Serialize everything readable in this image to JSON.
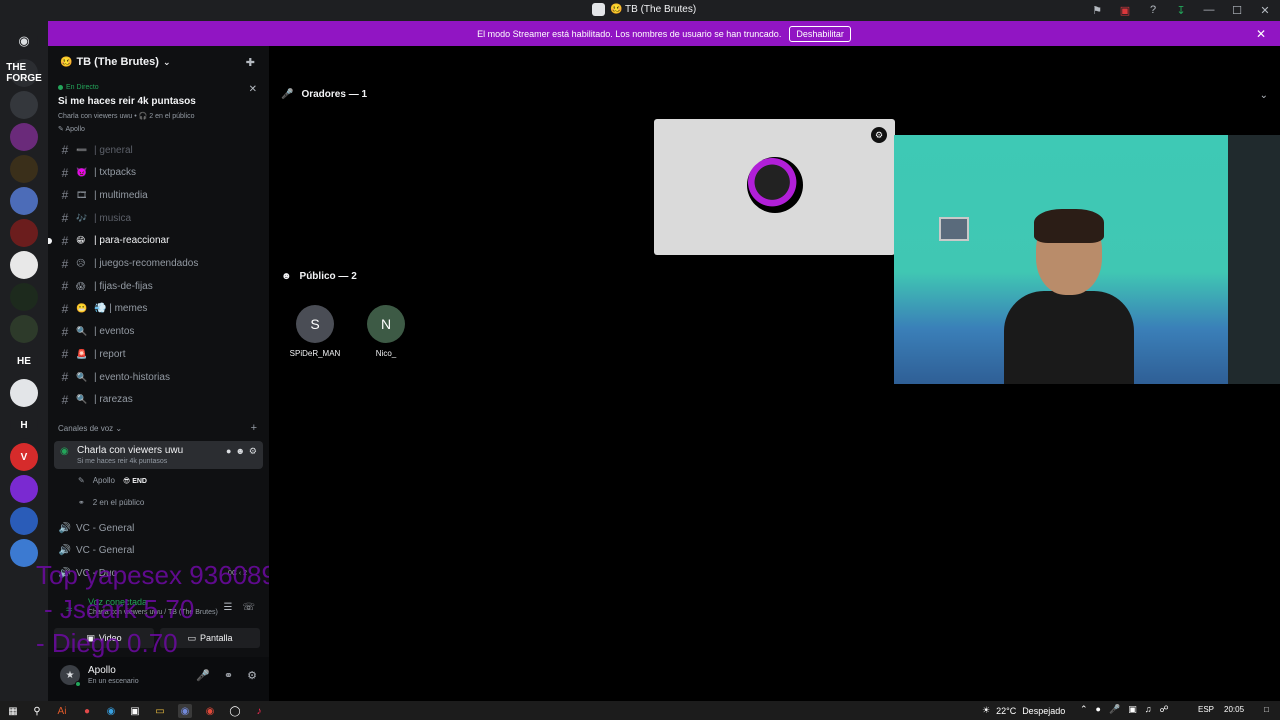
{
  "titlebar": {
    "title": "🥴 TB (The Brutes)",
    "icons": [
      "inbox-icon",
      "stream-icon",
      "help-icon",
      "download-icon",
      "minimize-icon",
      "maximize-icon",
      "close-icon"
    ]
  },
  "rail": {
    "home_icon": "discord-icon",
    "servers": [
      {
        "label": "THE FORGE",
        "color": "#2b2d31"
      },
      {
        "label": "",
        "color": "#34373c"
      },
      {
        "label": "",
        "color": "#6a2a7a"
      },
      {
        "label": "",
        "color": "#3a2f1a"
      },
      {
        "label": "",
        "color": "#4c6cb8"
      },
      {
        "label": "",
        "color": "#6b1d1d"
      },
      {
        "label": "",
        "color": "#e8e8e8"
      },
      {
        "label": "",
        "color": "#1d2a1d"
      },
      {
        "label": "",
        "color": "#2d3a2a"
      },
      {
        "label": "HE",
        "color": "#1e1f22"
      },
      {
        "label": "",
        "color": "#e3e5e8"
      },
      {
        "label": "H",
        "color": "#1e1f22"
      },
      {
        "label": "V",
        "color": "#d62b2b"
      },
      {
        "label": "",
        "color": "#7a2ad1"
      },
      {
        "label": "",
        "color": "#2a5cb8"
      },
      {
        "label": "",
        "color": "#3c7ad1"
      }
    ]
  },
  "banner": {
    "text": "El modo Streamer está habilitado. Los nombres de usuario se han truncado.",
    "button": "Deshabilitar"
  },
  "sidebar": {
    "server_name": "TB (The Brutes)",
    "server_emoji": "🥴",
    "stage": {
      "live_label": "En Directo",
      "title": "Si me haces reir 4k puntasos",
      "meta": "Charla con viewers uwu • 🎧 2 en el público",
      "speaker": "Apollo"
    },
    "channels": [
      {
        "emoji": "➖",
        "name": "| general",
        "state": "muted"
      },
      {
        "emoji": "👿",
        "name": "| txtpacks",
        "state": "normal"
      },
      {
        "emoji": "🎞",
        "name": "| multimedia",
        "state": "normal"
      },
      {
        "emoji": "🎶",
        "name": "| musica",
        "state": "muted"
      },
      {
        "emoji": "😁",
        "name": "| para-reaccionar",
        "state": "bold"
      },
      {
        "emoji": "😥",
        "name": "| juegos-recomendados",
        "state": "normal"
      },
      {
        "emoji": "😱",
        "name": "| fijas-de-fijas",
        "state": "normal"
      },
      {
        "emoji": "😬",
        "name": "💨 | memes",
        "state": "normal"
      },
      {
        "emoji": "🔍",
        "name": "| eventos",
        "state": "normal"
      },
      {
        "emoji": "🚨",
        "name": "| report",
        "state": "normal"
      },
      {
        "emoji": "🔍",
        "name": "| evento-historias",
        "state": "normal"
      },
      {
        "emoji": "🔍",
        "name": "| rarezas",
        "state": "normal"
      }
    ],
    "voice_category": "Canales de voz",
    "active_voice": {
      "name": "Charla con viewers uwu",
      "topic": "Si me haces reir 4k puntasos",
      "speaker": "Apollo",
      "speaker_badge": "😎 END",
      "audience": "2 en el público"
    },
    "voice_channels": [
      {
        "name": "VC - General",
        "extra": ""
      },
      {
        "name": "VC - General",
        "extra": ""
      },
      {
        "name": "VC - Duo",
        "extra": "0C  ‹ 2"
      }
    ],
    "voice_panel": {
      "status": "Voz conectada",
      "sub": "Charla con viewers uwu / TB (The Brutes)",
      "video": "Video",
      "screen": "Pantalla"
    },
    "user": {
      "name": "Apollo",
      "status": "En un escenario"
    }
  },
  "overlay": {
    "lines": [
      "Top yapesex 936089711",
      "- Jsdark 5.70",
      "- Diego 0.70"
    ]
  },
  "main": {
    "speakers_header": "Oradores — 1",
    "audience_header": "Público — 2",
    "audience": [
      {
        "name": "SPiDeR_MAN",
        "initial": "S",
        "color": "#4a4d55"
      },
      {
        "name": "Nico_",
        "initial": "N",
        "color": "#3d5a45"
      }
    ]
  },
  "taskbar": {
    "weather_temp": "22°C",
    "weather_text": "Despejado",
    "lang": "ESP",
    "time": "20:05"
  }
}
